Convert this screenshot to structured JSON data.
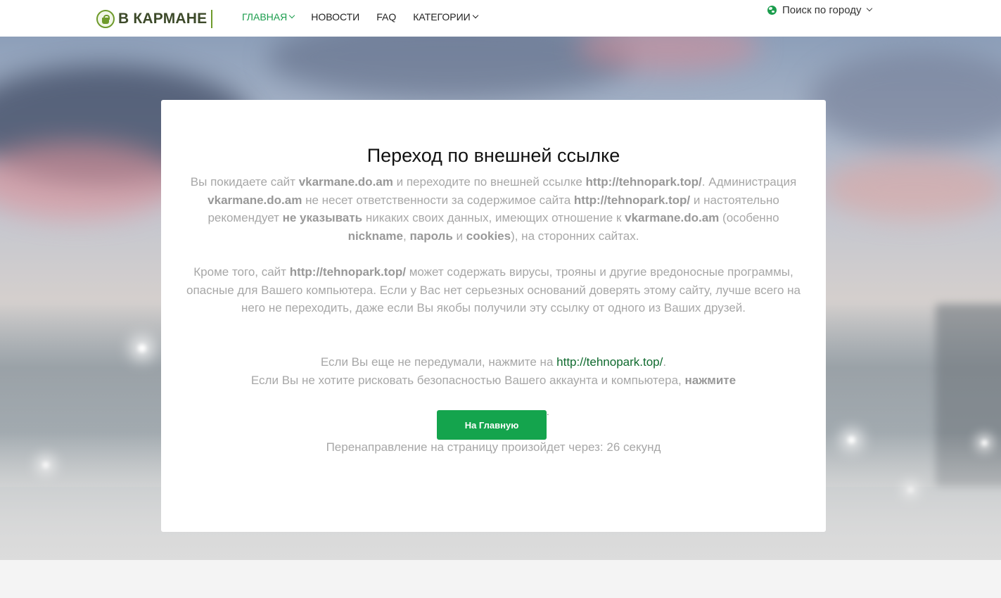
{
  "header": {
    "logo_text": "В КАРМАНЕ",
    "nav": [
      {
        "label": "ГЛАВНАЯ",
        "active": true,
        "dropdown": true
      },
      {
        "label": "НОВОСТИ",
        "active": false,
        "dropdown": false
      },
      {
        "label": "FAQ",
        "active": false,
        "dropdown": false
      },
      {
        "label": "КАТЕГОРИИ",
        "active": false,
        "dropdown": true
      }
    ],
    "city_search": "Поиск по городу"
  },
  "colors": {
    "accent": "#1b9d4d",
    "button": "#14a44d",
    "link": "#0f6a2e",
    "logo": "#6e9a2b"
  },
  "icons": [
    "logo-bag-icon",
    "chevron-down-icon",
    "globe-icon"
  ],
  "card": {
    "title": "Переход по внешней ссылке",
    "site": "vkarmane.do.am",
    "target_url": "http://tehnopark.top/",
    "p1": {
      "t1": "Вы покидаете сайт",
      "t2": "и переходите по внешней ссылке",
      "t3": ". Администрация",
      "t4": "не несет ответственности за содержимое сайта",
      "t5": "и настоятельно рекомендует",
      "b_no_data": "не указывать",
      "t6": "никаких своих данных, имеющих отношение к",
      "t7": "(особенно",
      "b_nickname": "nickname",
      "comma": ",",
      "b_password": "пароль",
      "t8": "и",
      "b_cookies": "cookies",
      "t9": "), на сторонних сайтах."
    },
    "p2": {
      "t1": "Кроме того, сайт",
      "t2": "может содержать вирусы, трояны и другие вредоносные программы, опасные для Вашего компьютера. Если у Вас нет серьезных оснований доверять этому сайту, лучше всего на него не переходить, даже если Вы якобы получили эту ссылку от одного из Ваших друзей."
    },
    "p3": {
      "t1": "Если Вы еще не передумали, нажмите на",
      "dot": ".",
      "t2": "Если Вы не хотите рисковать безопасностью Вашего аккаунта и компьютера,",
      "b_click": "нажмите"
    },
    "button_label": "На Главную",
    "after_button": ".",
    "redirect_text": "Перенаправление на страницу произойдет через: 26 секунд"
  }
}
